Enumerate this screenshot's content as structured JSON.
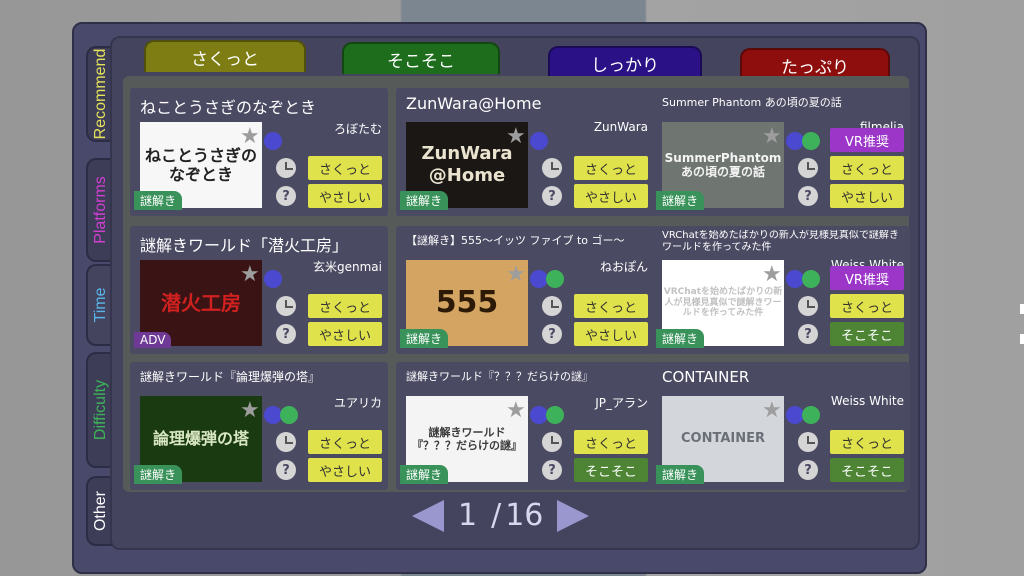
{
  "side_tabs": [
    {
      "label": "Recommend",
      "color": "#e5e25b"
    },
    {
      "label": "Platforms",
      "color": "#d23fd2"
    },
    {
      "label": "Time",
      "color": "#58b7ea"
    },
    {
      "label": "Difficulty",
      "color": "#3db557"
    },
    {
      "label": "Other",
      "color": "#ffffff"
    }
  ],
  "top_tabs": [
    {
      "label": "さくっと",
      "color": "#7d7d14"
    },
    {
      "label": "そこそこ",
      "color": "#1e6d1c"
    },
    {
      "label": "しっかり",
      "color": "#2a1186"
    },
    {
      "label": "たっぷり",
      "color": "#8e0e0e"
    }
  ],
  "cards": [
    {
      "title": "ねことうさぎのなぞとき",
      "author": "ろぼたむ",
      "thumb": "ねことうさぎの なぞとき",
      "chip": "謎解き",
      "dots": [
        "blue"
      ],
      "tags": [
        {
          "label": "さくっと",
          "style": "yellow"
        },
        {
          "label": "やさしい",
          "style": "yellow"
        }
      ]
    },
    {
      "title": "ZunWara@Home",
      "author": "ZunWara",
      "thumb": "ZunWara @Home",
      "chip": "謎解き",
      "dots": [
        "blue"
      ],
      "tags": [
        {
          "label": "さくっと",
          "style": "yellow"
        },
        {
          "label": "やさしい",
          "style": "yellow"
        }
      ]
    },
    {
      "title": "Summer Phantom あの頃の夏の話",
      "author": "filmelia",
      "thumb": "SummerPhantom あの頃の夏の話",
      "chip": "謎解き",
      "dots": [
        "blue",
        "green"
      ],
      "tags": [
        {
          "label": "VR推奨",
          "style": "purple"
        },
        {
          "label": "さくっと",
          "style": "yellow"
        },
        {
          "label": "やさしい",
          "style": "yellow"
        }
      ]
    },
    {
      "title": "謎解きワールド「潜火工房」",
      "author": "玄米genmai",
      "thumb": "潜火工房",
      "chip": "ADV",
      "chip_style": "purple",
      "dots": [
        "blue"
      ],
      "tags": [
        {
          "label": "さくっと",
          "style": "yellow"
        },
        {
          "label": "やさしい",
          "style": "yellow"
        }
      ]
    },
    {
      "title": "【謎解き】555〜イッツ ファイブ to ゴー〜",
      "author": "ねおぽん",
      "thumb": "555",
      "chip": "謎解き",
      "dots": [
        "blue",
        "green"
      ],
      "tags": [
        {
          "label": "さくっと",
          "style": "yellow"
        },
        {
          "label": "やさしい",
          "style": "yellow"
        }
      ]
    },
    {
      "title": "VRChatを始めたばかりの新人が見様見真似で謎解きワールドを作ってみた件",
      "author": "Weiss White",
      "thumb": "VRChatを始めたばかりの新人が見様見真似で謎解きワールドを作ってみた件",
      "chip": "謎解き",
      "dots": [
        "blue",
        "green"
      ],
      "tags": [
        {
          "label": "VR推奨",
          "style": "purple"
        },
        {
          "label": "さくっと",
          "style": "yellow"
        },
        {
          "label": "そこそこ",
          "style": "green"
        }
      ]
    },
    {
      "title": "謎解きワールド『論理爆弾の塔』",
      "author": "ユアリカ",
      "thumb": "論理爆弾の塔",
      "chip": "謎解き",
      "dots": [
        "blue",
        "green"
      ],
      "tags": [
        {
          "label": "さくっと",
          "style": "yellow"
        },
        {
          "label": "やさしい",
          "style": "yellow"
        }
      ]
    },
    {
      "title": "謎解きワールド『？？？だらけの謎』",
      "author": "JP_アラン",
      "thumb": "謎解きワールド 『？？？だらけの謎』",
      "chip": "謎解き",
      "dots": [
        "blue",
        "green"
      ],
      "tags": [
        {
          "label": "さくっと",
          "style": "yellow"
        },
        {
          "label": "そこそこ",
          "style": "green"
        }
      ]
    },
    {
      "title": "CONTAINER",
      "author": "Weiss White",
      "thumb": "CONTAINER",
      "chip": "謎解き",
      "dots": [
        "blue",
        "green"
      ],
      "tags": [
        {
          "label": "さくっと",
          "style": "yellow"
        },
        {
          "label": "そこそこ",
          "style": "green"
        }
      ]
    }
  ],
  "pager": {
    "current": "1",
    "separator": "/",
    "total": "16"
  },
  "icons": {
    "favorite": "star-icon",
    "time": "clock-icon",
    "difficulty": "question-icon"
  }
}
